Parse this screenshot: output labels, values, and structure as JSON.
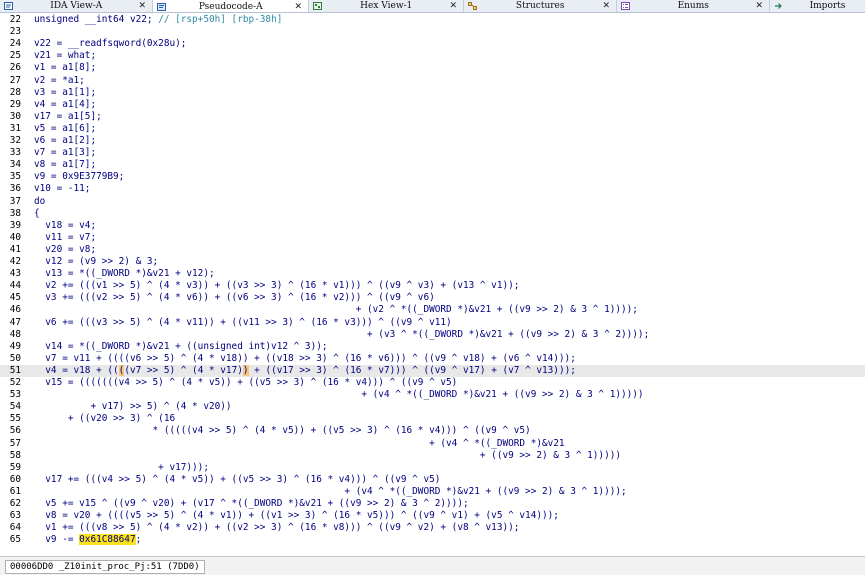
{
  "tabs": [
    {
      "label": "IDA View-A",
      "close": "✕",
      "icon": "disassembly-icon"
    },
    {
      "label": "Pseudocode-A",
      "close": "✕",
      "icon": "pseudocode-icon"
    },
    {
      "label": "Hex View-1",
      "close": "✕",
      "icon": "hex-view-icon"
    },
    {
      "label": "Structures",
      "close": "✕",
      "icon": "structures-icon"
    },
    {
      "label": "Enums",
      "close": "✕",
      "icon": "enums-icon"
    },
    {
      "label": "Imports",
      "close": "",
      "icon": "imports-icon"
    }
  ],
  "active_tab": "Pseudocode-A",
  "code_lines": [
    {
      "num": "22",
      "code": "unsigned __int64 v22; // [rsp+50h] [rbp-38h]"
    },
    {
      "num": "23",
      "code": ""
    },
    {
      "num": "24",
      "code": "v22 = __readfsqword(0x28u);"
    },
    {
      "num": "25",
      "code": "v21 = what;"
    },
    {
      "num": "26",
      "code": "v1 = a1[8];"
    },
    {
      "num": "27",
      "code": "v2 = *a1;"
    },
    {
      "num": "28",
      "code": "v3 = a1[1];"
    },
    {
      "num": "29",
      "code": "v4 = a1[4];"
    },
    {
      "num": "30",
      "code": "v17 = a1[5];"
    },
    {
      "num": "31",
      "code": "v5 = a1[6];"
    },
    {
      "num": "32",
      "code": "v6 = a1[2];"
    },
    {
      "num": "33",
      "code": "v7 = a1[3];"
    },
    {
      "num": "34",
      "code": "v8 = a1[7];"
    },
    {
      "num": "35",
      "code": "v9 = 0x9E3779B9;"
    },
    {
      "num": "36",
      "code": "v10 = -11;"
    },
    {
      "num": "37",
      "code": "do"
    },
    {
      "num": "38",
      "code": "{"
    },
    {
      "num": "39",
      "code": "  v18 = v4;"
    },
    {
      "num": "40",
      "code": "  v11 = v7;"
    },
    {
      "num": "41",
      "code": "  v20 = v8;"
    },
    {
      "num": "42",
      "code": "  v12 = (v9 >> 2) & 3;"
    },
    {
      "num": "43",
      "code": "  v13 = *((_DWORD *)&v21 + v12);"
    },
    {
      "num": "44",
      "code": "  v2 += (((v1 >> 5) ^ (4 * v3)) + ((v3 >> 3) ^ (16 * v1))) ^ ((v9 ^ v3) + (v13 ^ v1));"
    },
    {
      "num": "45",
      "code": "  v3 += (((v2 >> 5) ^ (4 * v6)) + ((v6 >> 3) ^ (16 * v2))) ^ ((v9 ^ v6)"
    },
    {
      "num": "46",
      "code": "                                                         + (v2 ^ *((_DWORD *)&v21 + ((v9 >> 2) & 3 ^ 1))));"
    },
    {
      "num": "47",
      "code": "  v6 += (((v3 >> 5) ^ (4 * v11)) + ((v11 >> 3) ^ (16 * v3))) ^ ((v9 ^ v11)"
    },
    {
      "num": "48",
      "code": "                                                           + (v3 ^ *((_DWORD *)&v21 + ((v9 >> 2) & 3 ^ 2))));"
    },
    {
      "num": "49",
      "code": "  v14 = *((_DWORD *)&v21 + ((unsigned int)v12 ^ 3));"
    },
    {
      "num": "50",
      "code": "  v7 = v11 + ((((v6 >> 5) ^ (4 * v18)) + ((v18 >> 3) ^ (16 * v6))) ^ ((v9 ^ v18) + (v6 ^ v14)));"
    },
    {
      "num": "51",
      "code": "  v4 = v18 + ((((v7 >> 5) ^ (4 * v17)) + ((v17 >> 3) ^ (16 * v7))) ^ ((v9 ^ v17) + (v7 ^ v13)));",
      "current": true
    },
    {
      "num": "52",
      "code": "  v15 = (((((((v4 >> 5) ^ (4 * v5)) + ((v5 >> 3) ^ (16 * v4))) ^ ((v9 ^ v5)"
    },
    {
      "num": "53",
      "code": "                                                          + (v4 ^ *((_DWORD *)&v21 + ((v9 >> 2) & 3 ^ 1)))))"
    },
    {
      "num": "54",
      "code": "          + v17) >> 5) ^ (4 * v20))"
    },
    {
      "num": "55",
      "code": "      + ((v20 >> 3) ^ (16"
    },
    {
      "num": "56",
      "code": "                     * (((((v4 >> 5) ^ (4 * v5)) + ((v5 >> 3) ^ (16 * v4))) ^ ((v9 ^ v5)"
    },
    {
      "num": "57",
      "code": "                                                                      + (v4 ^ *((_DWORD *)&v21"
    },
    {
      "num": "58",
      "code": "                                                                               + ((v9 >> 2) & 3 ^ 1)))))"
    },
    {
      "num": "59",
      "code": "                      + v17)));"
    },
    {
      "num": "60",
      "code": "  v17 += (((v4 >> 5) ^ (4 * v5)) + ((v5 >> 3) ^ (16 * v4))) ^ ((v9 ^ v5)"
    },
    {
      "num": "61",
      "code": "                                                       + (v4 ^ *((_DWORD *)&v21 + ((v9 >> 2) & 3 ^ 1))));"
    },
    {
      "num": "62",
      "code": "  v5 += v15 ^ ((v9 ^ v20) + (v17 ^ *((_DWORD *)&v21 + ((v9 >> 2) & 3 ^ 2))));"
    },
    {
      "num": "63",
      "code": "  v8 = v20 + ((((v5 >> 5) ^ (4 * v1)) + ((v1 >> 3) ^ (16 * v5))) ^ ((v9 ^ v1) + (v5 ^ v14)));"
    },
    {
      "num": "64",
      "code": "  v1 += (((v8 >> 5) ^ (4 * v2)) + ((v2 >> 3) ^ (16 * v8))) ^ ((v9 ^ v2) + (v8 ^ v13));"
    },
    {
      "num": "65",
      "code": "  v9 -= 0x61C88647;"
    }
  ],
  "status": {
    "text": "00006DD0 _Z10init_proc_Pj:51 (7DD0)"
  },
  "colors": {
    "code_text": "#000080",
    "comment": "#2e8ba6",
    "current_line": "#e8e8e8",
    "highlight": "#fbe21d",
    "paren_match": "#f5c87e"
  }
}
